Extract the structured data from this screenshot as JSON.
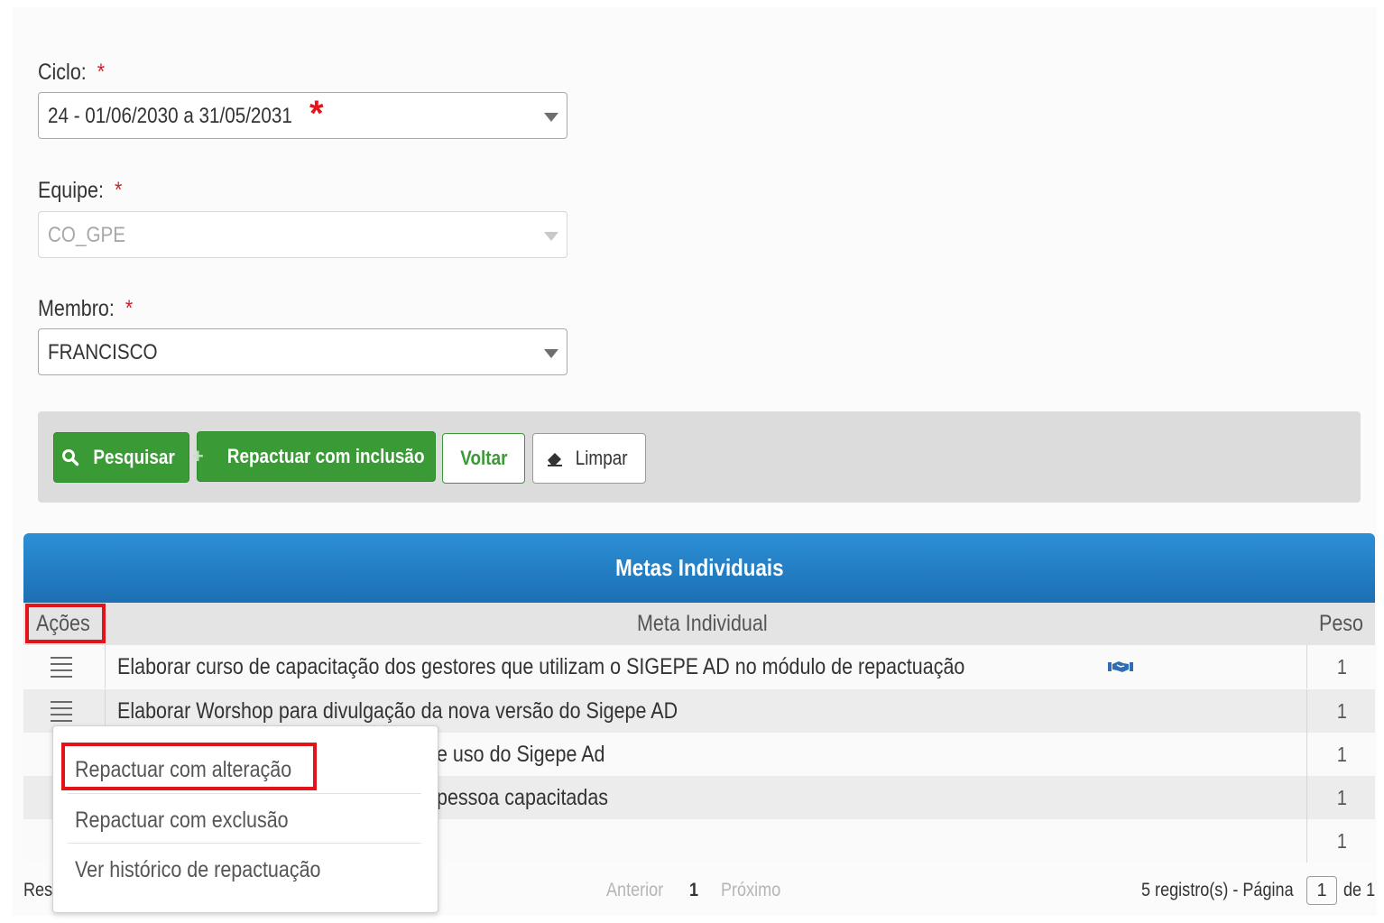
{
  "form": {
    "ciclo": {
      "label": "Ciclo:",
      "required": "*",
      "value": "24 - 01/06/2030 a 31/05/2031",
      "highlight_star": "*"
    },
    "equipe": {
      "label": "Equipe:",
      "required": "*",
      "value": "CO_GPE",
      "disabled": true
    },
    "membro": {
      "label": "Membro:",
      "required": "*",
      "value": "FRANCISCO"
    }
  },
  "toolbar": {
    "pesquisar": "Pesquisar",
    "repactuar_inclusao": "Repactuar com inclusão",
    "voltar": "Voltar",
    "limpar": "Limpar"
  },
  "panel": {
    "title": "Metas Individuais",
    "columns": {
      "acoes": "Ações",
      "meta": "Meta Individual",
      "peso": "Peso"
    },
    "rows": [
      {
        "meta": "Elaborar curso de capacitação dos gestores que utilizam o SIGEPE AD no módulo de repactuação",
        "peso": "1",
        "icon": "handshake-icon"
      },
      {
        "meta": "Elaborar Worshop para divulgação da nova versão do Sigepe AD",
        "peso": "1"
      },
      {
        "meta": "e uso do Sigepe Ad",
        "peso": "1"
      },
      {
        "meta": "pessoa capacitadas",
        "peso": "1"
      },
      {
        "meta": "",
        "peso": "1"
      }
    ]
  },
  "dropdown": {
    "items": [
      "Repactuar com alteração",
      "Repactuar com exclusão",
      "Ver histórico de repactuação"
    ]
  },
  "footer": {
    "left": "Res",
    "prev": "Anterior",
    "page": "1",
    "next": "Próximo",
    "records": "5 registro(s) - Página",
    "current_page": "1",
    "of": "de 1"
  },
  "colors": {
    "primary_green": "#3a9a35",
    "header_blue": "#1f78c1",
    "highlight_red": "#e0141a"
  }
}
